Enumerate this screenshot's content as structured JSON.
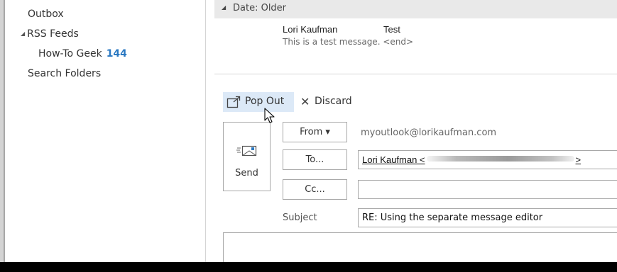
{
  "sidebar": {
    "items": [
      {
        "label": "Outbox"
      },
      {
        "label": "RSS Feeds"
      },
      {
        "label": "How-To Geek",
        "count": "144"
      },
      {
        "label": "Search Folders"
      }
    ]
  },
  "message_list": {
    "group_header": "Date: Older",
    "message": {
      "sender": "Lori Kaufman",
      "subject": "Test",
      "preview": "This is a test message. <end>"
    }
  },
  "compose": {
    "toolbar": {
      "pop_out_label": "Pop Out",
      "discard_label": "Discard"
    },
    "send_label": "Send",
    "from_label": "From ▾",
    "from_value": "myoutlook@lorikaufman.com",
    "to_label": "To...",
    "to_name": "Lori Kaufman <",
    "to_suffix": ">",
    "cc_label": "Cc...",
    "cc_value": "",
    "subject_label": "Subject",
    "subject_value": "RE: Using the separate message editor",
    "body_value": ""
  },
  "colors": {
    "accent": "#2b79c2",
    "selected_button": "#dce9f7",
    "group_header_bg": "#e9e9e9"
  },
  "icons": {
    "pop_out": "pop-out-icon",
    "discard": "close-icon",
    "send": "send-envelope-icon",
    "expand": "expand-triangle-icon",
    "cursor": "mouse-pointer-icon"
  }
}
